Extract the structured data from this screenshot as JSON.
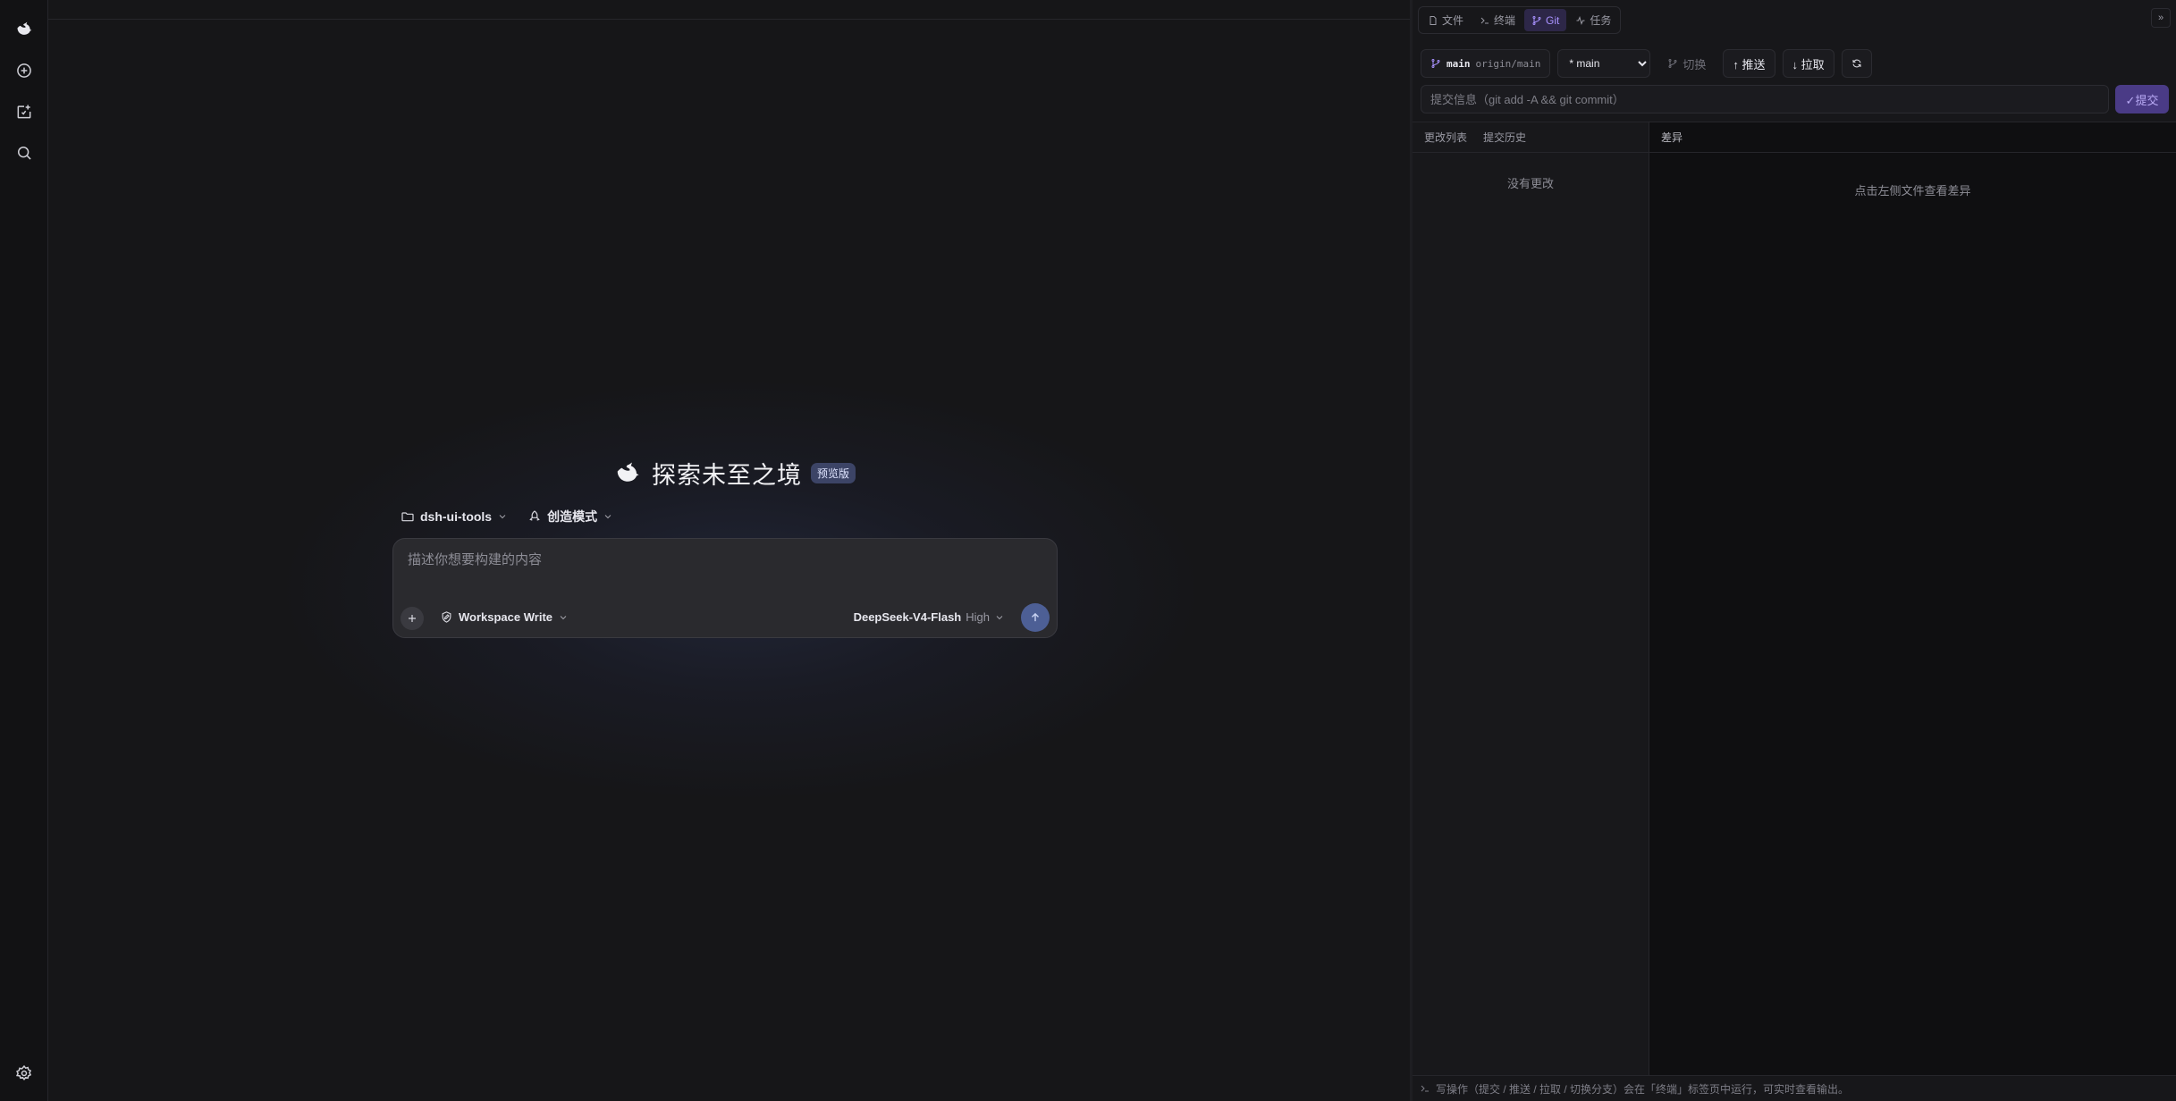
{
  "rail": {
    "logo_icon": "whale-logo-icon",
    "items": [
      {
        "name": "new-chat-icon"
      },
      {
        "name": "new-task-icon"
      },
      {
        "name": "search-icon"
      },
      {
        "name": "settings-icon"
      }
    ]
  },
  "hero": {
    "title": "探索未至之境",
    "badge": "预览版"
  },
  "context": {
    "folder": "dsh-ui-tools",
    "mode": "创造模式"
  },
  "composer": {
    "placeholder": "描述你想要构建的内容",
    "permission": "Workspace Write",
    "model": "DeepSeek-V4-Flash",
    "level": "High"
  },
  "panel": {
    "tabs": [
      {
        "label": "文件",
        "icon": "file-icon"
      },
      {
        "label": "终端",
        "icon": "terminal-icon"
      },
      {
        "label": "Git",
        "icon": "git-branch-icon",
        "active": true
      },
      {
        "label": "任务",
        "icon": "activity-icon"
      }
    ],
    "collapse_label": "»",
    "branch": {
      "name": "main",
      "remote": "origin/main"
    },
    "branch_select": {
      "selected": "* main",
      "options": [
        "* main"
      ]
    },
    "switch_label": "切换",
    "push_label": "↑ 推送",
    "pull_label": "↓ 拉取",
    "commit": {
      "placeholder": "提交信息（git add -A && git commit）",
      "button": "✓提交"
    },
    "sub_tabs": [
      "更改列表",
      "提交历史"
    ],
    "empty_changes": "没有更改",
    "diff_header": "差异",
    "diff_empty": "点击左侧文件查看差异",
    "status": "写操作（提交 / 推送 / 拉取 / 切换分支）会在「终端」标签页中运行，可实时查看输出。"
  },
  "colors": {
    "accent": "#a992ff",
    "send": "#4d5f95",
    "commit": "#4a3b86"
  }
}
